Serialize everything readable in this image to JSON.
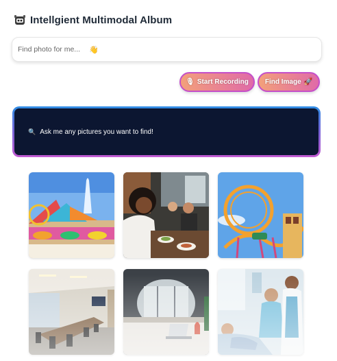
{
  "header": {
    "title": "Intellgient Multimodal Album",
    "logo_icon": "robot-face-icon"
  },
  "search": {
    "placeholder": "Find photo for me...",
    "value": "",
    "emoji_icon": "wave-emoji-icon"
  },
  "buttons": {
    "record_label": "Start Recording",
    "record_icon": "microphone-icon",
    "find_label": "Find Image",
    "find_icon": "rocket-icon"
  },
  "result": {
    "icon": "magnifier-icon",
    "text": "Ask me any pictures you want to find!"
  },
  "gallery": {
    "photos": [
      {
        "subject": "amusement-park-waterpark"
      },
      {
        "subject": "friends-dining"
      },
      {
        "subject": "roller-coaster"
      },
      {
        "subject": "conference-room"
      },
      {
        "subject": "office-workspace"
      },
      {
        "subject": "hospital-medical-staff"
      }
    ]
  },
  "colors": {
    "title": "#1f2a37",
    "panel_bg": "#0c1631",
    "button_gradient_start": "#f3a07a",
    "button_gradient_end": "#e06aa8",
    "button_border": "#c44fc9"
  }
}
